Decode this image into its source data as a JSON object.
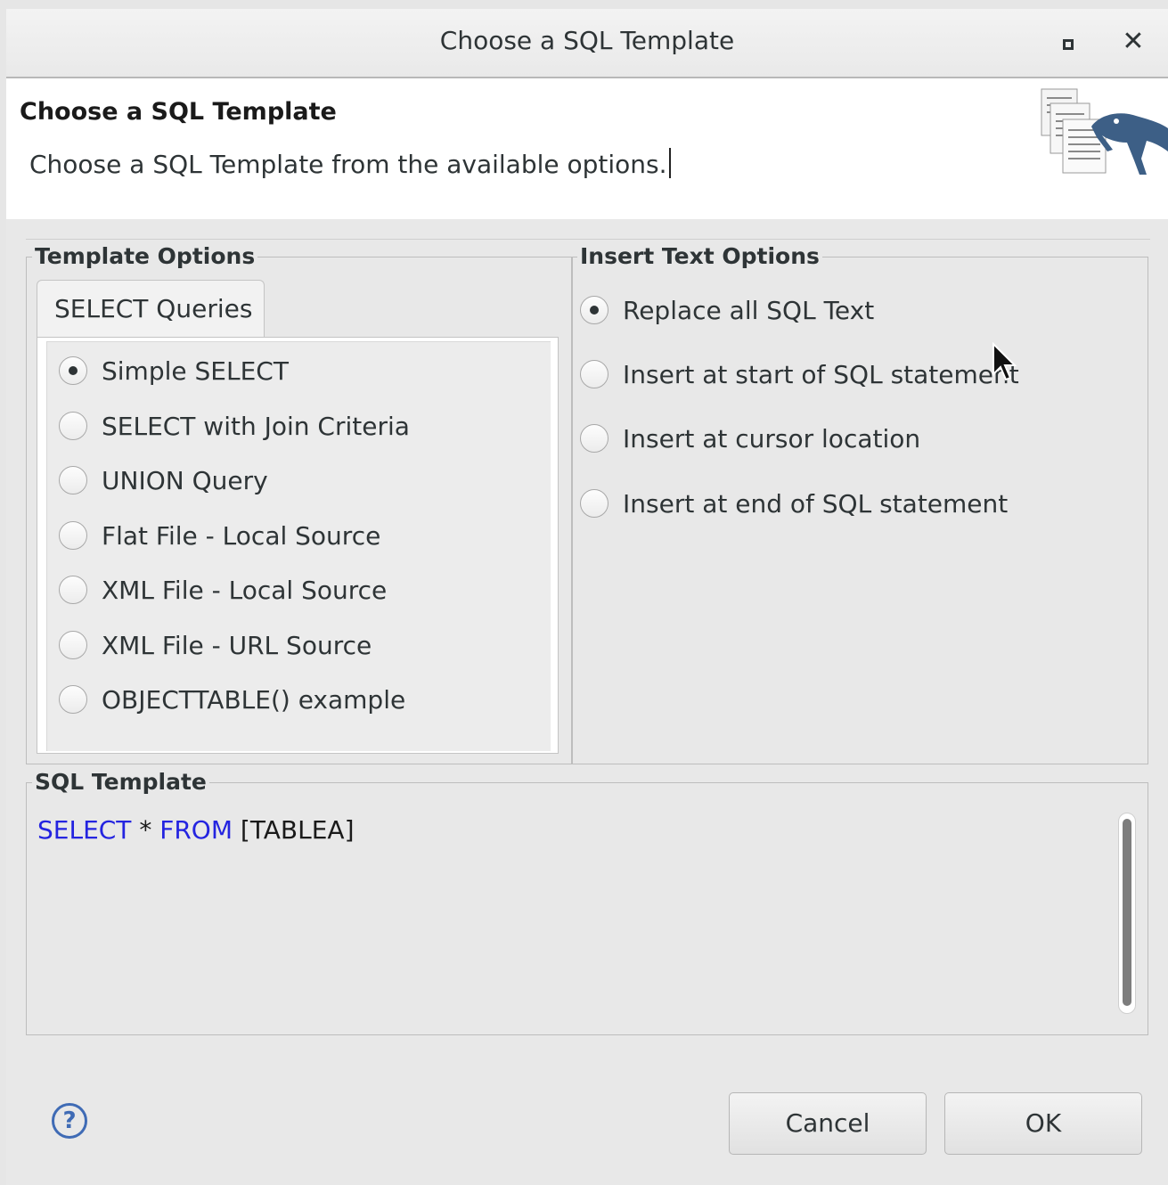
{
  "window": {
    "title": "Choose a SQL Template"
  },
  "header": {
    "title": "Choose a SQL Template",
    "description": "Choose a SQL Template from the available options."
  },
  "template_options": {
    "group_title": "Template Options",
    "tab_label": "SELECT Queries",
    "options": [
      {
        "label": "Simple SELECT",
        "checked": true
      },
      {
        "label": "SELECT with Join Criteria",
        "checked": false
      },
      {
        "label": "UNION Query",
        "checked": false
      },
      {
        "label": "Flat File - Local Source",
        "checked": false
      },
      {
        "label": "XML File - Local Source",
        "checked": false
      },
      {
        "label": "XML File - URL Source",
        "checked": false
      },
      {
        "label": "OBJECTTABLE() example",
        "checked": false
      }
    ]
  },
  "insert_options": {
    "group_title": "Insert Text Options",
    "options": [
      {
        "label": "Replace all SQL Text",
        "checked": true
      },
      {
        "label": "Insert at start of SQL statement",
        "checked": false
      },
      {
        "label": "Insert at cursor location",
        "checked": false
      },
      {
        "label": "Insert at end of SQL statement",
        "checked": false
      }
    ]
  },
  "sql_template": {
    "group_title": "SQL Template",
    "tokens": {
      "kw1": "SELECT",
      "star": " * ",
      "kw2": "FROM",
      "table": " [TABLEA]"
    }
  },
  "buttons": {
    "help": "?",
    "cancel": "Cancel",
    "ok": "OK"
  },
  "icons": {
    "maximize": "maximize-icon",
    "close": "close-icon",
    "help": "help-icon",
    "banner": "wizard-banner-icon"
  }
}
